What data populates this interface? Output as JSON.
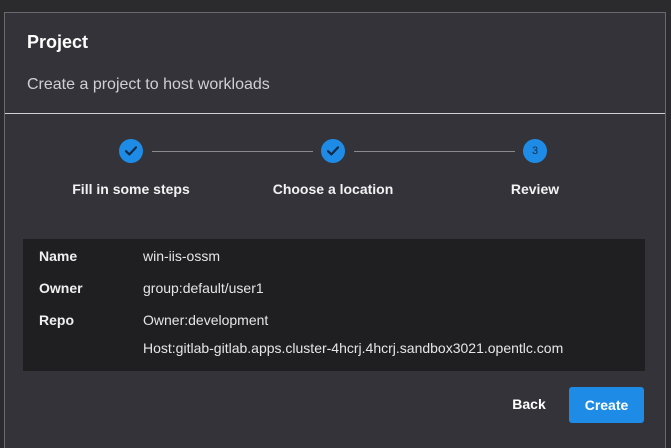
{
  "dialog": {
    "title": "Project",
    "subtitle": "Create a project to host workloads"
  },
  "stepper": {
    "steps": [
      {
        "label": "Fill in some steps",
        "state": "complete",
        "icon": "check-icon"
      },
      {
        "label": "Choose a location",
        "state": "complete",
        "icon": "check-icon"
      },
      {
        "label": "Review",
        "state": "current",
        "number": "3"
      }
    ]
  },
  "review": {
    "rows": [
      {
        "key": "Name",
        "value": "win-iis-ossm"
      },
      {
        "key": "Owner",
        "value": "group:default/user1"
      },
      {
        "key": "Repo",
        "value": "Owner:development",
        "value2": "Host:gitlab-gitlab.apps.cluster-4hcrj.4hcrj.sandbox3021.opentlc.com"
      }
    ]
  },
  "footer": {
    "back_label": "Back",
    "create_label": "Create"
  },
  "colors": {
    "accent": "#1e8ce6",
    "background": "#333339",
    "panel": "#1f1f22"
  }
}
